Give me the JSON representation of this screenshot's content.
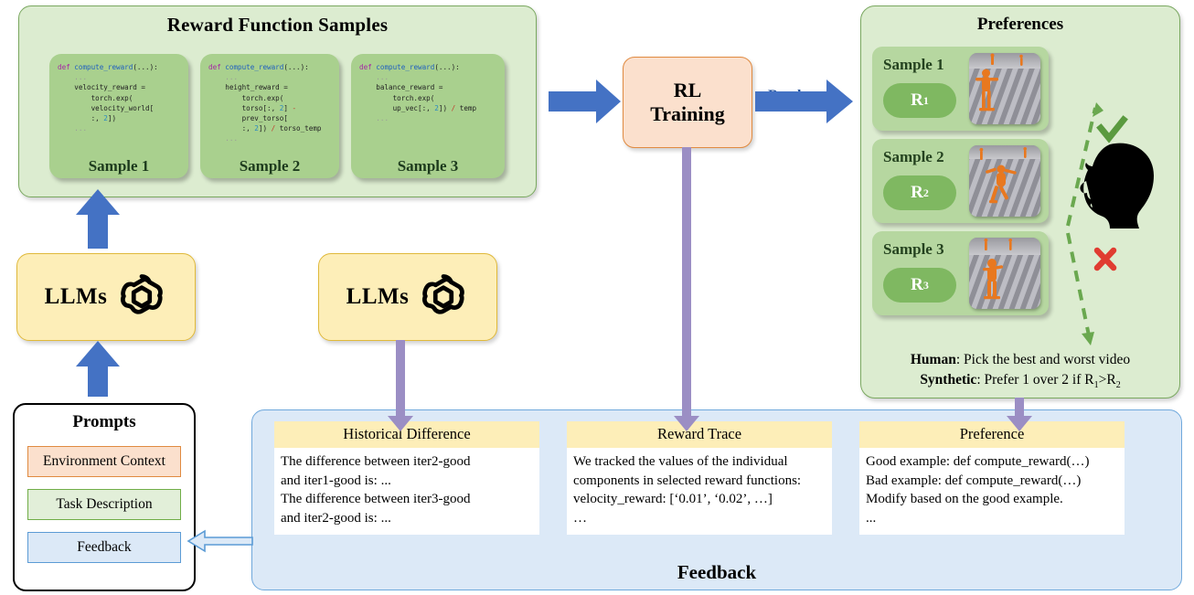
{
  "reward_samples": {
    "title": "Reward Function Samples",
    "cards": [
      {
        "label": "Sample 1",
        "code_lines": [
          {
            "t": "def ",
            "c": "kw"
          },
          {
            "t": "compute_reward",
            "c": "fn"
          },
          {
            "t": "(...):",
            "c": ""
          },
          {
            "t": "\n    ",
            "c": ""
          },
          {
            "t": "...",
            "c": "dots"
          },
          {
            "t": "\n    velocity_reward =\n        torch.exp(\n        velocity_world[\n        :, ",
            "c": ""
          },
          {
            "t": "2",
            "c": "num"
          },
          {
            "t": "])\n    ",
            "c": ""
          },
          {
            "t": "...",
            "c": "dots"
          }
        ]
      },
      {
        "label": "Sample 2",
        "code_lines": [
          {
            "t": "def ",
            "c": "kw"
          },
          {
            "t": "compute_reward",
            "c": "fn"
          },
          {
            "t": "(...):",
            "c": ""
          },
          {
            "t": "\n    ",
            "c": ""
          },
          {
            "t": "...",
            "c": "dots"
          },
          {
            "t": "\n    height_reward =\n        torch.exp(\n        torso[:, ",
            "c": ""
          },
          {
            "t": "2",
            "c": "num"
          },
          {
            "t": "] ",
            "c": ""
          },
          {
            "t": "-",
            "c": "op"
          },
          {
            "t": "\n        prev_torso[\n        :, ",
            "c": ""
          },
          {
            "t": "2",
            "c": "num"
          },
          {
            "t": "]) ",
            "c": ""
          },
          {
            "t": "/",
            "c": "op"
          },
          {
            "t": " torso_temp\n    ",
            "c": ""
          },
          {
            "t": "...",
            "c": "dots"
          }
        ]
      },
      {
        "label": "Sample 3",
        "code_lines": [
          {
            "t": "def ",
            "c": "kw"
          },
          {
            "t": "compute_reward",
            "c": "fn"
          },
          {
            "t": "(...):",
            "c": ""
          },
          {
            "t": "\n    ",
            "c": ""
          },
          {
            "t": "...",
            "c": "dots"
          },
          {
            "t": "\n    balance_reward =\n        torch.exp(\n        up_vec[:, ",
            "c": ""
          },
          {
            "t": "2",
            "c": "num"
          },
          {
            "t": "]) ",
            "c": ""
          },
          {
            "t": "/",
            "c": "op"
          },
          {
            "t": " temp\n    ",
            "c": ""
          },
          {
            "t": "...",
            "c": "dots"
          }
        ]
      }
    ]
  },
  "rl_training": {
    "label": "RL\nTraining",
    "line1": "RL",
    "line2": "Training"
  },
  "render_arrow": {
    "label": "Render"
  },
  "preferences": {
    "title": "Preferences",
    "samples": [
      {
        "name": "Sample 1",
        "reward": "R",
        "sub": "1"
      },
      {
        "name": "Sample 2",
        "reward": "R",
        "sub": "2"
      },
      {
        "name": "Sample 3",
        "reward": "R",
        "sub": "3"
      }
    ],
    "note_human_label": "Human",
    "note_human_text": ": Pick the best and worst video",
    "note_synth_label": "Synthetic",
    "note_synth_text": ": Prefer 1 over 2 if R",
    "note_synth_sub1": "1",
    "note_synth_mid": ">R",
    "note_synth_sub2": "2",
    "check_mark": "✔",
    "cross_mark": "✘"
  },
  "llms": {
    "label": "LLMs",
    "icon": "openai-logo"
  },
  "prompts": {
    "title": "Prompts",
    "chips": [
      {
        "label": "Environment Context"
      },
      {
        "label": "Task Description"
      },
      {
        "label": "Feedback"
      }
    ]
  },
  "feedback": {
    "title": "Feedback",
    "cards": [
      {
        "head": "Historical Difference",
        "body": "The difference between iter2-good\nand iter1-good is: ...\nThe difference between iter3-good\nand iter2-good is: ..."
      },
      {
        "head": "Reward Trace",
        "body": "We tracked the values of the individual\ncomponents in selected reward functions:\nvelocity_reward: [‘0.01’, ‘0.02’, …]\n…"
      },
      {
        "head": "Preference",
        "body": "Good example: def compute_reward(…)\nBad example: def compute_reward(…)\nModify based on the good example.\n..."
      }
    ]
  },
  "colors": {
    "panel_green": "#dcecd0",
    "card_green": "#a9d08e",
    "sample_green": "#b6d7a0",
    "pill_green": "#7fb861",
    "rl_orange": "#fbe0cd",
    "llm_yellow": "#fdeeb8",
    "feedback_blue": "#dce9f7",
    "arrow_blue": "#4472c4",
    "arrow_purple": "#9b8ec4",
    "check_green": "#6aa84f",
    "cross_red": "#e03c31"
  }
}
